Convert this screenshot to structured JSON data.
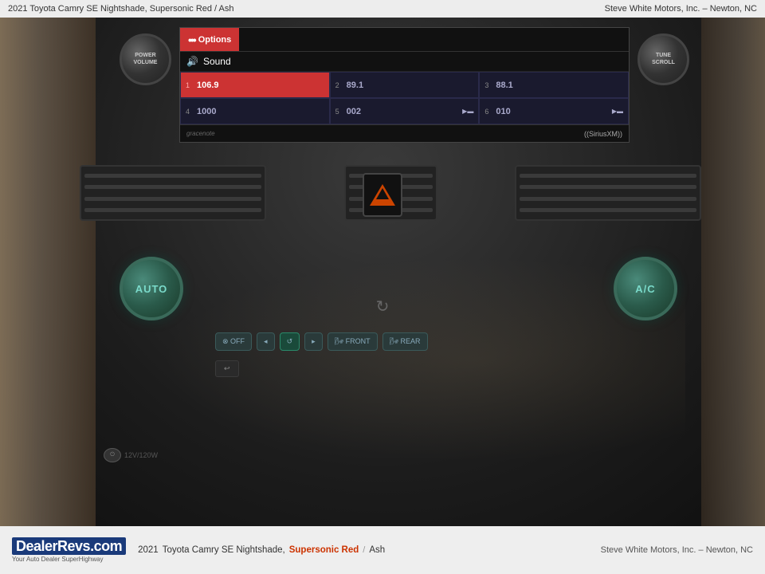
{
  "top_bar": {
    "left_text": "2021 Toyota Camry SE Nightshade,   Supersonic Red / Ash",
    "right_text": "Steve White Motors, Inc. – Newton, NC"
  },
  "infotainment": {
    "options_label": "Options",
    "sound_label": "Sound",
    "options_dots": "•••",
    "knob_left_line1": "POWER",
    "knob_left_line2": "VOLUME",
    "knob_right_line1": "TUNE",
    "knob_right_line2": "SCROLL",
    "radio_stations": [
      {
        "num": "1",
        "freq": "106.9",
        "icons": "",
        "active": true
      },
      {
        "num": "2",
        "freq": "89.1",
        "icons": "",
        "active": false
      },
      {
        "num": "3",
        "freq": "88.1",
        "icons": "",
        "active": false
      },
      {
        "num": "4",
        "freq": "1000",
        "icons": "",
        "active": false
      },
      {
        "num": "5",
        "freq": "002",
        "icons": "▶",
        "active": false
      },
      {
        "num": "6",
        "freq": "010",
        "icons": "▶",
        "active": false
      }
    ],
    "gracenote": "gracenote",
    "siriusxm": "((SiriusXM))"
  },
  "climate": {
    "auto_label": "AUTO",
    "ac_label": "A/C",
    "off_label": "⊗ OFF",
    "fan_icon": "↺",
    "front_label": "🌬 FRONT",
    "rear_label": "🌬 REAR",
    "mode_btn": "↑→",
    "recirculate_icon": "↻"
  },
  "hazard": {
    "label": "hazard"
  },
  "outlet": {
    "label": "12V/120W"
  },
  "bottom_bar": {
    "dealer_name": "DealerRevs",
    "dealer_tagline": "Your Auto Dealer SuperHighway",
    "dealer_url": "DealerRevs.com",
    "car_year": "2021",
    "car_make_model": "Toyota Camry SE Nightshade,",
    "color_exterior": "Supersonic Red",
    "color_separator": "/",
    "color_interior": "Ash",
    "dealer_info": "Steve White Motors, Inc. – Newton, NC"
  }
}
